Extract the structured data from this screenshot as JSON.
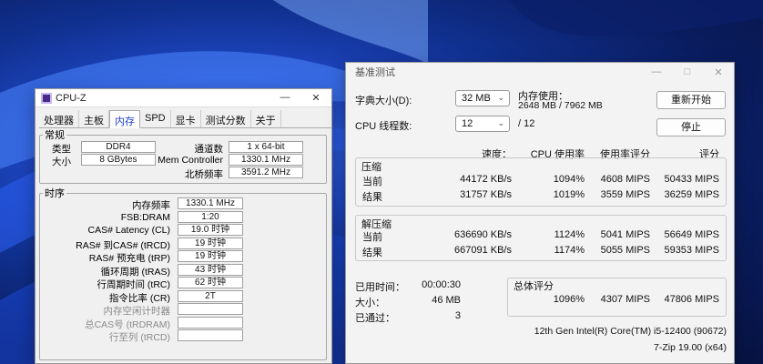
{
  "cpuz": {
    "title": "CPU-Z",
    "tabs": [
      "处理器",
      "主板",
      "内存",
      "SPD",
      "显卡",
      "测试分数",
      "关于"
    ],
    "active_tab": 2,
    "general": {
      "legend": "常规",
      "type_label": "类型",
      "type_value": "DDR4",
      "size_label": "大小",
      "size_value": "8 GBytes",
      "channels_label": "通道数",
      "channels_value": "1 x 64-bit",
      "mem_ctrl_label": "Mem Controller",
      "mem_ctrl_value": "1330.1 MHz",
      "nb_label": "北桥频率",
      "nb_value": "3591.2 MHz"
    },
    "timings": {
      "legend": "时序",
      "rows": [
        {
          "label": "内存频率",
          "value": "1330.1 MHz"
        },
        {
          "label": "FSB:DRAM",
          "value": "1:20"
        },
        {
          "label": "CAS# Latency (CL)",
          "value": "19.0 时钟"
        },
        {
          "label": "RAS# 到CAS# (tRCD)",
          "value": "19 时钟"
        },
        {
          "label": "RAS# 预充电 (tRP)",
          "value": "19 时钟"
        },
        {
          "label": "循环周期 (tRAS)",
          "value": "43 时钟"
        },
        {
          "label": "行周期时间 (tRC)",
          "value": "62 时钟"
        },
        {
          "label": "指令比率 (CR)",
          "value": "2T"
        },
        {
          "label": "内存空闲计时器",
          "value": ""
        },
        {
          "label": "总CAS号 (tRDRAM)",
          "value": ""
        },
        {
          "label": "行至列 (tRCD)",
          "value": ""
        }
      ]
    }
  },
  "bench": {
    "title": "基准测试",
    "dict_label": "字典大小(D):",
    "dict_value": "32 MB",
    "threads_label": "CPU 线程数:",
    "threads_value": "12",
    "threads_total": "/ 12",
    "mem_usage_label": "内存使用：",
    "mem_usage_value": "2648 MB / 7962 MB",
    "restart_button": "重新开始",
    "stop_button": "停止",
    "headers": [
      "速度：",
      "CPU 使用率",
      "使用率评分",
      "评分"
    ],
    "compress": {
      "title": "压缩",
      "rows": [
        {
          "label": "当前",
          "speed": "44172 KB/s",
          "cpu": "1094%",
          "usage": "4608 MIPS",
          "rating": "50433 MIPS"
        },
        {
          "label": "结果",
          "speed": "31757 KB/s",
          "cpu": "1019%",
          "usage": "3559 MIPS",
          "rating": "36259 MIPS"
        }
      ]
    },
    "decompress": {
      "title": "解压缩",
      "rows": [
        {
          "label": "当前",
          "speed": "636690 KB/s",
          "cpu": "1124%",
          "usage": "5041 MIPS",
          "rating": "56649 MIPS"
        },
        {
          "label": "结果",
          "speed": "667091 KB/s",
          "cpu": "1174%",
          "usage": "5055 MIPS",
          "rating": "59353 MIPS"
        }
      ]
    },
    "elapsed_label": "已用时间：",
    "elapsed_value": "00:00:30",
    "size_label": "大小：",
    "size_value": "46 MB",
    "passed_label": "已通过：",
    "passed_value": "3",
    "total_title": "总体评分",
    "total_cpu": "1096%",
    "total_usage": "4307 MIPS",
    "total_rating": "47806 MIPS",
    "cpu_name": "12th Gen Intel(R) Core(TM) i5-12400 (90672)",
    "version": "7-Zip 19.00 (x64)"
  }
}
